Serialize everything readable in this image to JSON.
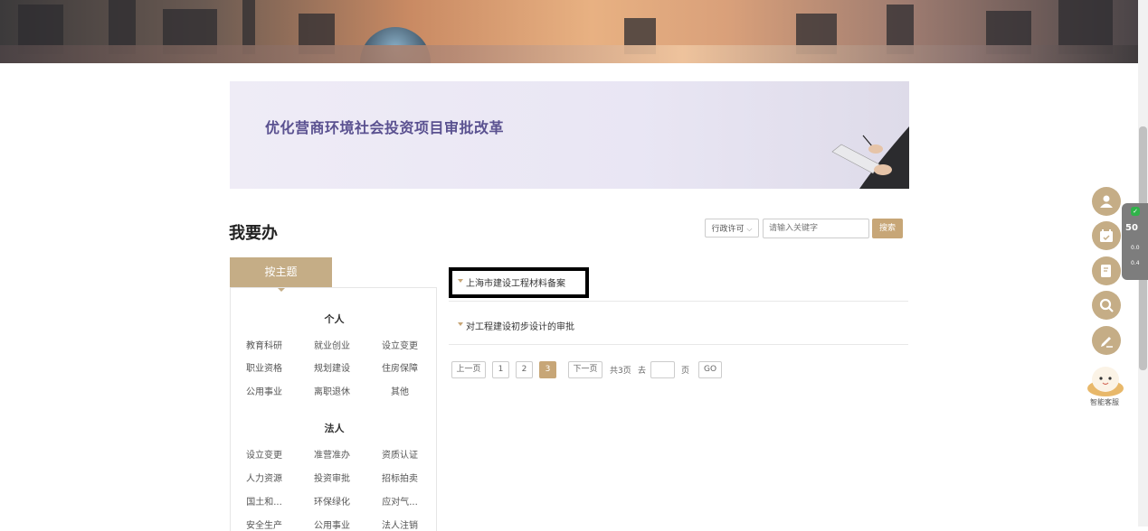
{
  "promo": {
    "title": "优化营商环境社会投资项目审批改革"
  },
  "page_title": "我要办",
  "search": {
    "category": "行政许可",
    "placeholder": "请输入关键字",
    "button": "搜索"
  },
  "sidebar": {
    "tab": "按主题",
    "groups": [
      {
        "title": "个人",
        "items": [
          "教育科研",
          "就业创业",
          "设立变更",
          "职业资格",
          "规划建设",
          "住房保障",
          "公用事业",
          "离职退休",
          "其他"
        ]
      },
      {
        "title": "法人",
        "items": [
          "设立变更",
          "准营准办",
          "资质认证",
          "人力资源",
          "投资审批",
          "招标拍卖",
          "国土和...",
          "环保绿化",
          "应对气...",
          "安全生产",
          "公用事业",
          "法人注销"
        ]
      }
    ]
  },
  "list": [
    {
      "label": "上海市建设工程材料备案"
    },
    {
      "label": "对工程建设初步设计的审批"
    }
  ],
  "pagination": {
    "prev": "上一页",
    "pages": [
      "1",
      "2",
      "3"
    ],
    "current": "3",
    "next": "下一页",
    "total_text": "共3页",
    "goto_label": "去",
    "page_label": "页",
    "go": "GO"
  },
  "float": {
    "service_label": "智能客服",
    "widget_value": "50",
    "widget_up": "0.0",
    "widget_down": "0.4"
  },
  "colors": {
    "accent": "#c7a677",
    "promo_text": "#5a5190",
    "float_btn": "#c5ad86"
  }
}
